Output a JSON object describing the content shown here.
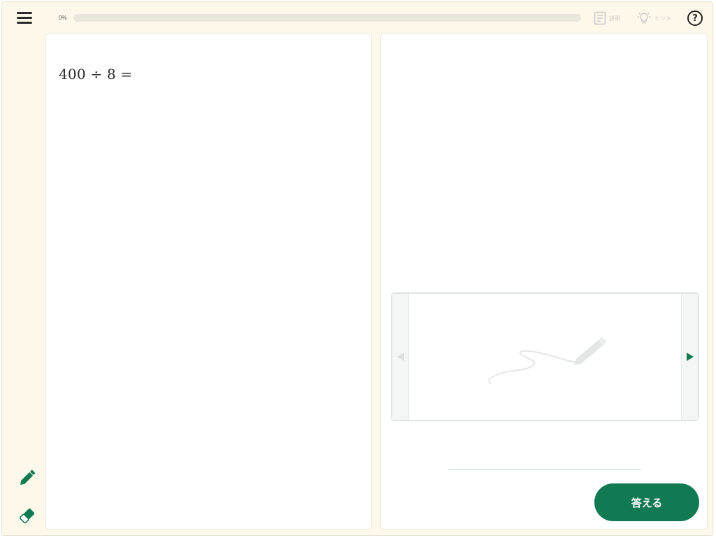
{
  "progress": {
    "label": "0%",
    "value": 0
  },
  "toolbar": {
    "explain_label": "説明",
    "hint_label": "ヒント"
  },
  "question": {
    "text": "400 ÷ 8 ="
  },
  "answer": {
    "button_label": "答える",
    "value": ""
  },
  "colors": {
    "accent": "#127a52",
    "background": "#fdf8ea",
    "panel": "#ffffff",
    "disabled": "#c9c9c9"
  },
  "icons": {
    "menu": "hamburger-menu-icon",
    "explain": "document-icon",
    "hint": "lightbulb-icon",
    "help": "question-circle-icon",
    "pencil": "pencil-icon",
    "eraser": "eraser-icon",
    "prev": "triangle-left-icon",
    "next": "triangle-right-icon"
  }
}
